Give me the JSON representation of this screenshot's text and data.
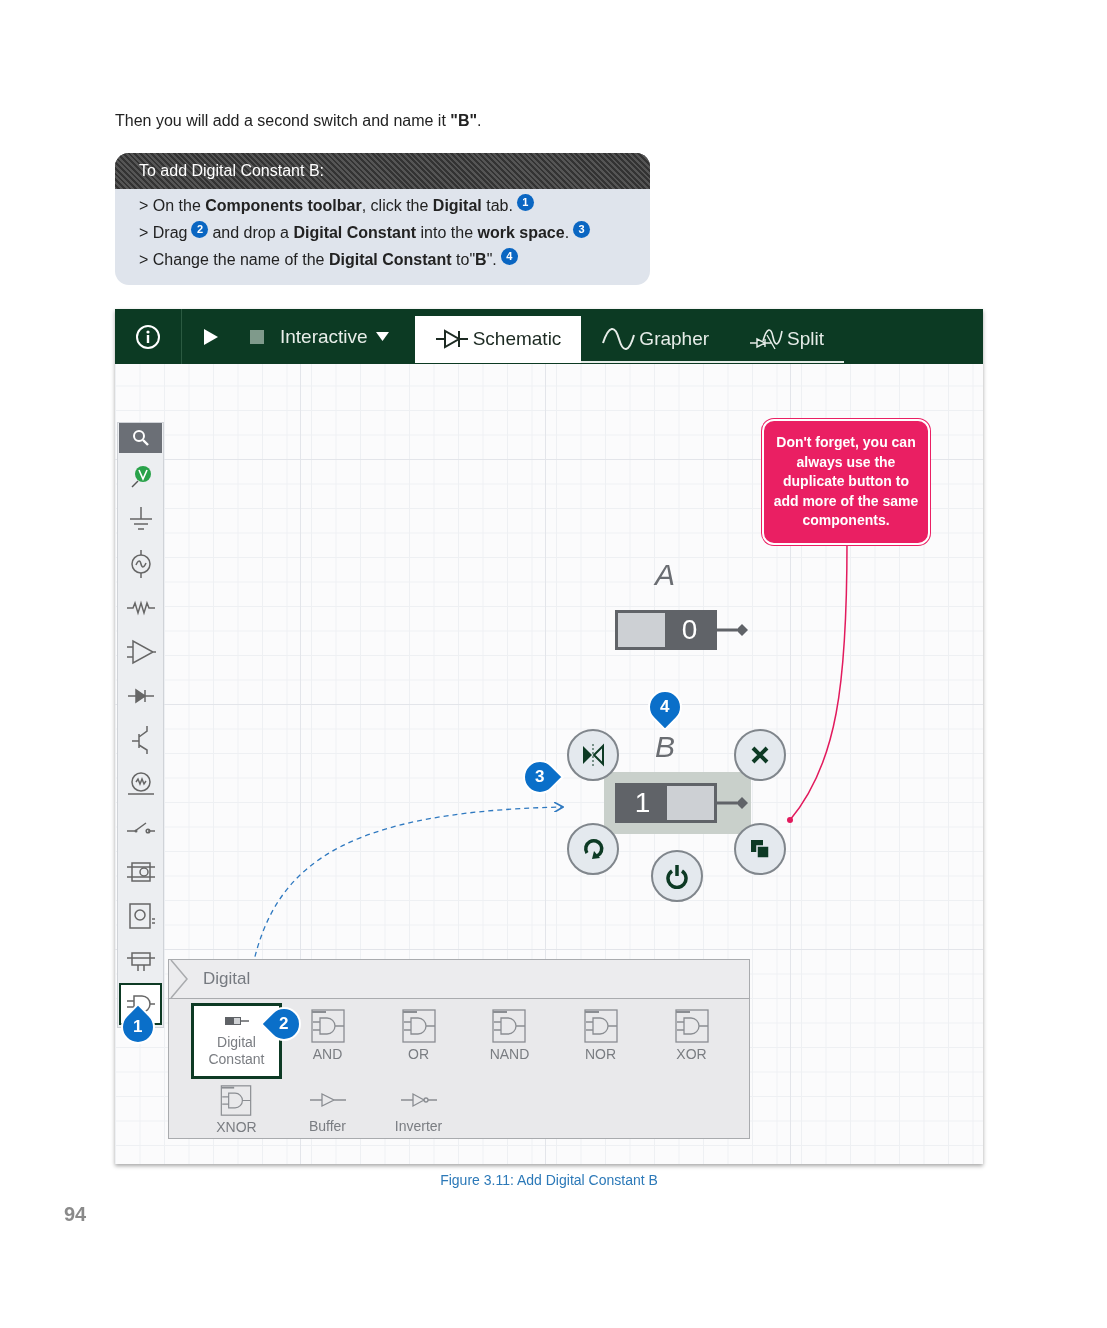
{
  "intro": "Then you will add a second switch and name it **\"B\"**.",
  "instructions": {
    "title": "To add Digital Constant B:",
    "steps": [
      {
        "segments": [
          {
            "kind": "text",
            "text": "> On the **Components toolbar**, click the **Digital** tab."
          },
          {
            "kind": "marker",
            "text": "1"
          }
        ]
      },
      {
        "segments": [
          {
            "kind": "text",
            "text": "> Drag"
          },
          {
            "kind": "marker",
            "text": "2"
          },
          {
            "kind": "text",
            "text": "and drop a **Digital Constant** into the **work space**."
          },
          {
            "kind": "marker",
            "text": "3"
          }
        ]
      },
      {
        "segments": [
          {
            "kind": "text",
            "text": "> Change the name of the **Digital Constant** to\"**B**\"."
          },
          {
            "kind": "marker",
            "text": "4"
          }
        ]
      }
    ]
  },
  "app": {
    "toolbar": {
      "mode": "Interactive",
      "tabs": [
        {
          "label": "Schematic",
          "kind": "schematic",
          "selected": true
        },
        {
          "label": "Grapher",
          "kind": "grapher",
          "selected": false
        },
        {
          "label": "Split",
          "kind": "split",
          "selected": false
        }
      ]
    },
    "tools": [
      {
        "kind": "search",
        "selected": false
      },
      {
        "kind": "voltmeter",
        "selected": false
      },
      {
        "kind": "ground",
        "selected": false
      },
      {
        "kind": "source",
        "selected": false
      },
      {
        "kind": "resistor",
        "selected": false
      },
      {
        "kind": "amplifier",
        "selected": false
      },
      {
        "kind": "diode",
        "selected": false
      },
      {
        "kind": "transistor",
        "selected": false
      },
      {
        "kind": "lamp",
        "selected": false
      },
      {
        "kind": "switch",
        "selected": false
      },
      {
        "kind": "relay",
        "selected": false
      },
      {
        "kind": "meter",
        "selected": false
      },
      {
        "kind": "chip",
        "selected": false
      },
      {
        "kind": "gate",
        "selected": true
      }
    ],
    "tip": "Don't forget, you can always use the duplicate button to add more of the same components.",
    "constants": [
      {
        "label": "A",
        "value": "0",
        "on": false,
        "selected": false
      },
      {
        "label": "B",
        "value": "1",
        "on": true,
        "selected": true
      }
    ],
    "markers": [
      {
        "text": "1"
      },
      {
        "text": "2"
      },
      {
        "text": "3"
      },
      {
        "text": "4"
      }
    ],
    "panel": {
      "title": "Digital",
      "items": [
        {
          "label": "Digital Constant",
          "kind": "constant",
          "selected": true
        },
        {
          "label": "AND",
          "kind": "gate",
          "selected": false
        },
        {
          "label": "OR",
          "kind": "gate",
          "selected": false
        },
        {
          "label": "NAND",
          "kind": "gate",
          "selected": false
        },
        {
          "label": "NOR",
          "kind": "gate",
          "selected": false
        },
        {
          "label": "XOR",
          "kind": "gate",
          "selected": false
        },
        {
          "label": "XNOR",
          "kind": "gate",
          "selected": false
        },
        {
          "label": "Buffer",
          "kind": "buffer",
          "selected": false
        },
        {
          "label": "Inverter",
          "kind": "inverter",
          "selected": false
        }
      ]
    }
  },
  "caption": "Figure 3.11: Add Digital Constant B",
  "page_number": "94"
}
